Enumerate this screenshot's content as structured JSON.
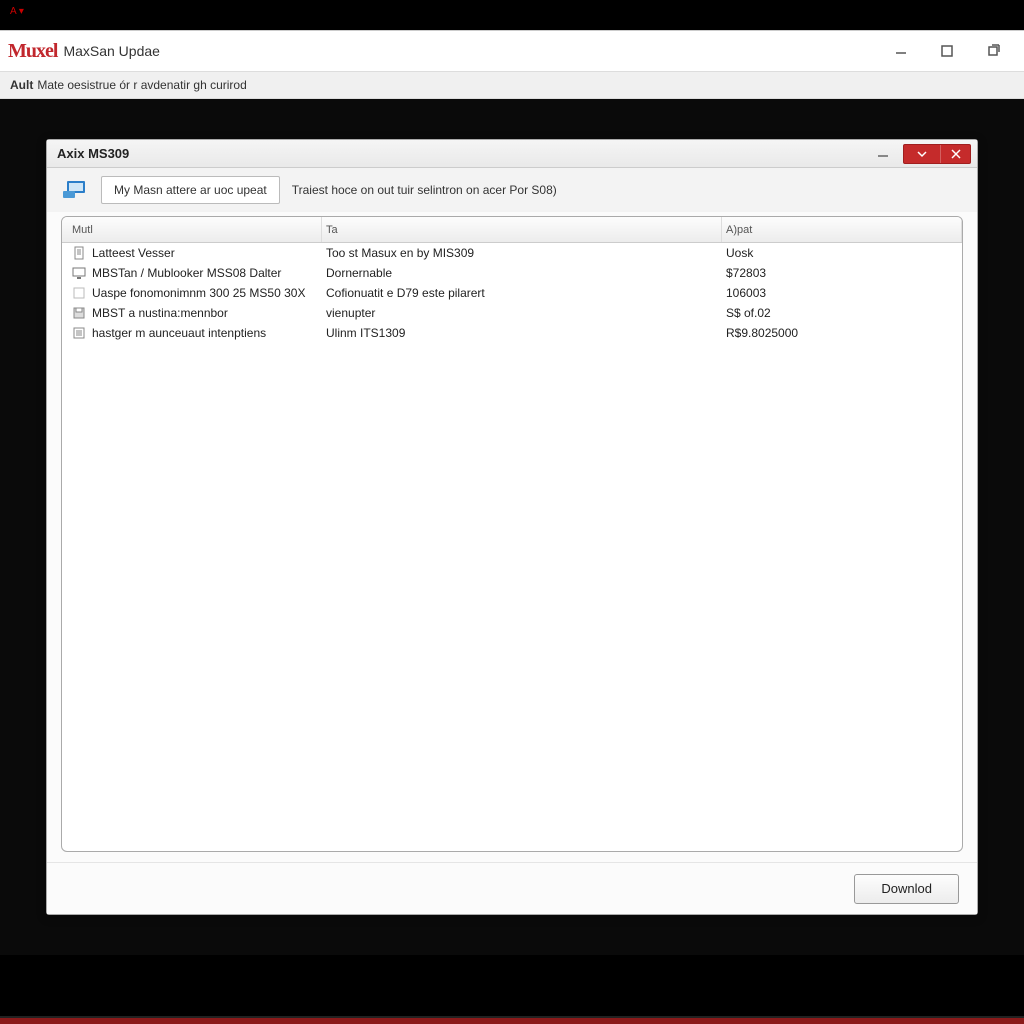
{
  "top_indicator": "A ▾",
  "app": {
    "logo": "Muxel",
    "title": "MaxSan Updae",
    "subheader_bold": "Ault",
    "subheader_text": "Mate oesistrue ór r avdenatir gh curirod"
  },
  "dialog": {
    "title": "Axix MS309",
    "device_button": "My Masn attere ar uoc upeat",
    "hint": "Traiest hoce on out tuir selintron on acer Por S08)",
    "columns": {
      "name": "Mutl",
      "desc": "Ta",
      "value": "A)pat"
    },
    "rows": [
      {
        "icon": "doc",
        "name": "Latteest Vesser",
        "desc": "Too st Masux en by MIS309",
        "value": "Uosk"
      },
      {
        "icon": "monitor",
        "name": "MBSTan / Mublooker MSS08 Dalter",
        "desc": "Dornernable",
        "value": "$72803"
      },
      {
        "icon": "blank",
        "name": "Uaspe fonomonimnm 300 25 MS50 30X",
        "desc": "Cofionuatit e D79 este pilarert",
        "value": "106003"
      },
      {
        "icon": "disk",
        "name": "MBST a nustina:mennbor",
        "desc": "vienupter",
        "value": "S$ of.02"
      },
      {
        "icon": "list",
        "name": "hastger m aunceuaut intenptiens",
        "desc": "Ulinm ITS1309",
        "value": "R$9.8025000"
      }
    ],
    "download": "Downlod"
  }
}
